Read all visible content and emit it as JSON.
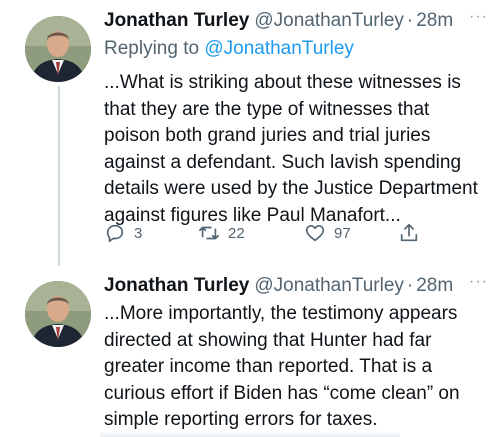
{
  "tweets": [
    {
      "author_name": "Jonathan Turley",
      "handle": "@JonathanTurley",
      "separator": "·",
      "time": "28m",
      "more": "···",
      "replying_prefix": "Replying to",
      "replying_to": "@JonathanTurley",
      "text": "...What is striking about these witnesses is that they are the type of witnesses that poison both grand juries and trial juries against a defendant. Such lavish spending details were used by the Justice Department against figures like Paul Manafort...",
      "replies": "3",
      "retweets": "22",
      "likes": "97"
    },
    {
      "author_name": "Jonathan Turley",
      "handle": "@JonathanTurley",
      "separator": "·",
      "time": "28m",
      "more": "···",
      "text": "...More importantly, the testimony appears directed at showing that Hunter had far greater income than reported. That is a curious effort if Biden has “come clean” on simple reporting errors for taxes."
    }
  ],
  "icons": {
    "reply": "reply-icon",
    "retweet": "retweet-icon",
    "like": "heart-icon",
    "share": "share-icon"
  },
  "colors": {
    "link": "#1d9bf0",
    "secondary_text": "#536471",
    "thread_line": "#cfd9de"
  }
}
